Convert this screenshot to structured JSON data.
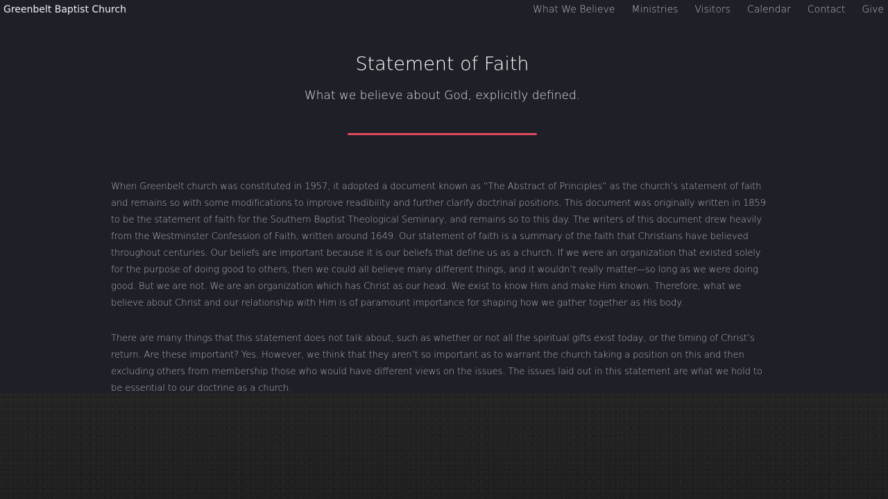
{
  "navbar": {
    "brand": "Greenbelt Baptist Church",
    "links": [
      {
        "label": "What We Believe"
      },
      {
        "label": "Ministries"
      },
      {
        "label": "Visitors"
      },
      {
        "label": "Calendar"
      },
      {
        "label": "Contact"
      },
      {
        "label": "Give"
      }
    ]
  },
  "hero": {
    "title": "Statement of Faith",
    "subtitle": "What we believe about God, explicitly defined."
  },
  "content": {
    "paragraphs": [
      "When Greenbelt church was constituted in 1957, it adopted a document known as “The Abstract of Principles” as the church’s statement of faith and remains so with some modifications to improve readibility and further clarify doctrinal positions. This document was originally written in 1859 to be the statement of faith for the Southern Baptist Theological Seminary, and remains so to this day. The writers of this document drew heavily from the Westminster Confession of Faith, written around 1649. Our statement of faith is a summary of the faith that Christians have believed throughout centuries. Our beliefs are important because it is our beliefs that define us as a church. If we were an organization that existed solely for the purpose of doing good to others, then we could all believe many different things, and it wouldn’t really matter—so long as we were doing good. But we are not. We are an organization which has Christ as our head. We exist to know Him and make Him known. Therefore, what we believe about Christ and our relationship with Him is of paramount importance for shaping how we gather together as His body.",
      "There are many things that this statement does not talk about, such as whether or not all the spiritual gifts exist today, or the timing of Christ’s return. Are these important? Yes. However, we think that they aren’t so important as to warrant the church taking a position on this and then excluding others from membership those who would have different views on the issues. The issues laid out in this statement are what we hold to be essential to our doctrine as a church."
    ]
  },
  "colors": {
    "background": "#1e1f27",
    "accent": "#e0485f",
    "footer": "#222222"
  }
}
